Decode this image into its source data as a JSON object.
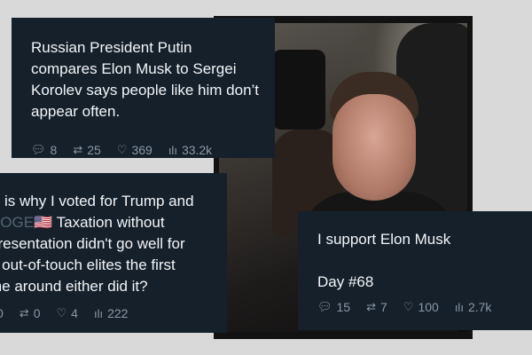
{
  "card1": {
    "text": "Russian President Putin compares Elon Musk to Sergei Korolev says people like him don’t appear often.",
    "replies": "8",
    "reposts": "25",
    "likes": "369",
    "views": "33.2k"
  },
  "card2": {
    "line1": "is is why I voted for Trump and",
    "line2_doge": "DOGE",
    "line2_flag": "🇺🇸",
    "line2_rest": " Taxation without",
    "line3": "presentation didn't go well for",
    "line4": "e out-of-touch elites the first",
    "line5": "me around either did it?",
    "replies": "0",
    "reposts": "0",
    "likes": "4",
    "views": "222"
  },
  "card3": {
    "line1": "I support Elon Musk",
    "line2": "Day #68",
    "replies": "15",
    "reposts": "7",
    "likes": "100",
    "views": "2.7k"
  },
  "icons": {
    "reply": "speech-bubble",
    "repost": "repost-arrows",
    "like": "heart",
    "views": "bar-chart"
  }
}
